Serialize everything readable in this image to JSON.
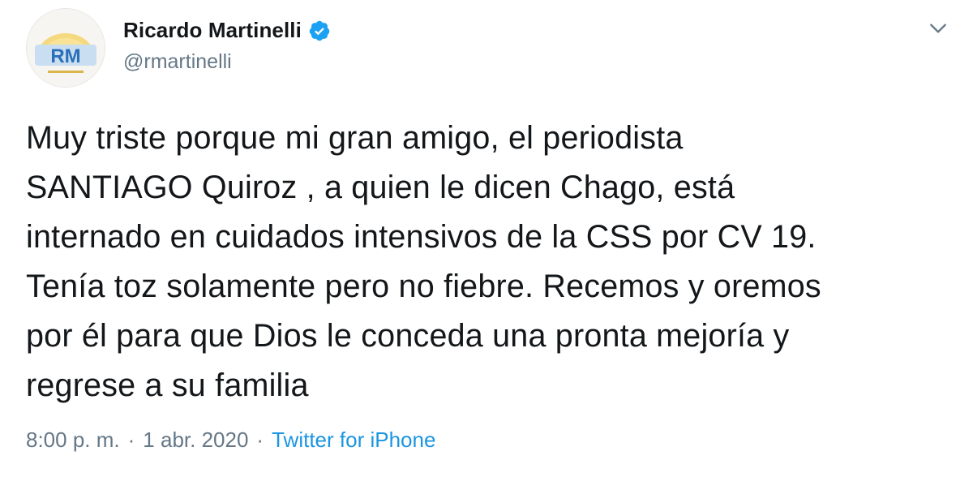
{
  "author": {
    "display_name": "Ricardo Martinelli",
    "handle": "@rmartinelli",
    "avatar_text": "RM",
    "verified": true
  },
  "tweet": {
    "text": "Muy triste porque mi gran amigo, el periodista\nSANTIAGO Quiroz , a quien le dicen Chago, está\ninternado en cuidados intensivos de la CSS por CV 19.\nTenía toz solamente pero no fiebre. Recemos y oremos\npor él para que Dios le conceda una pronta mejoría y\nregrese a su familia",
    "time": "8:00 p. m.",
    "separator": "·",
    "date": "1 abr. 2020",
    "source": "Twitter for iPhone"
  },
  "icons": {
    "verified": "verified-badge-icon",
    "menu": "chevron-down-icon"
  },
  "colors": {
    "accent": "#1b95e0",
    "text": "#14171a",
    "muted": "#657786",
    "verified": "#1da1f2"
  }
}
